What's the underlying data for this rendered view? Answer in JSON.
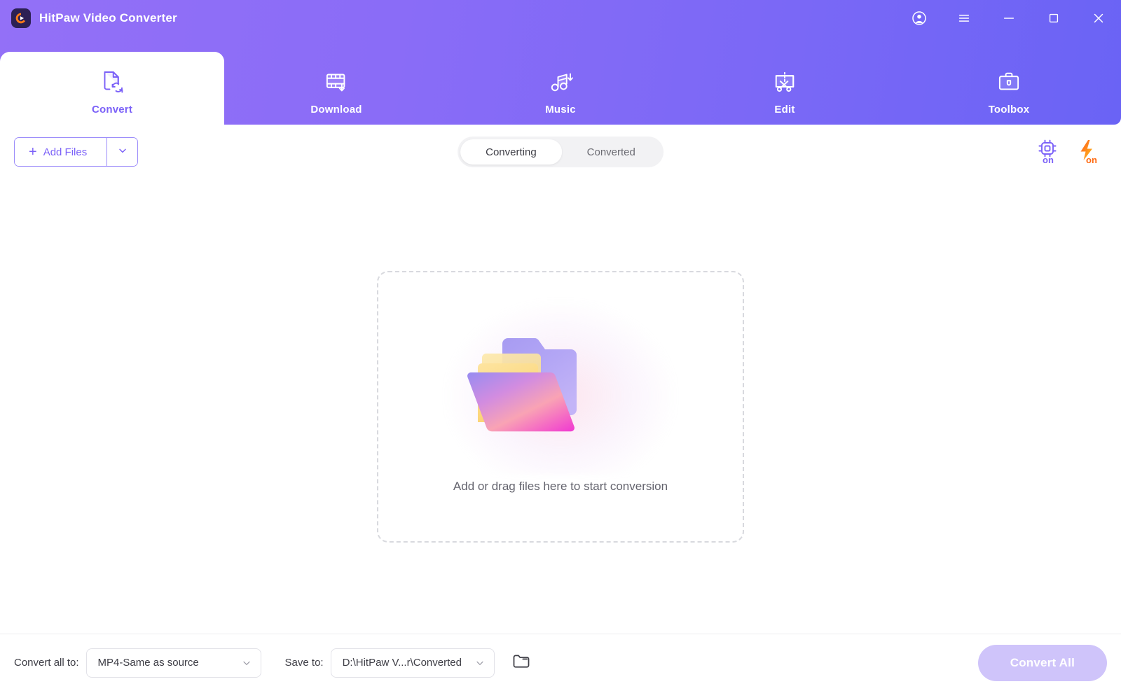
{
  "window": {
    "app_title": "HitPaw Video Converter",
    "logo_icon": "hitpaw-logo-icon",
    "controls": [
      {
        "name": "account-icon",
        "label": "Account"
      },
      {
        "name": "menu-icon",
        "label": "Menu"
      },
      {
        "name": "minimize-icon",
        "label": "Minimize"
      },
      {
        "name": "maximize-icon",
        "label": "Maximize"
      },
      {
        "name": "close-icon",
        "label": "Close"
      }
    ]
  },
  "nav": {
    "tabs": [
      {
        "label": "Convert",
        "icon": "file-convert-icon",
        "active": true
      },
      {
        "label": "Download",
        "icon": "film-download-icon",
        "active": false
      },
      {
        "label": "Music",
        "icon": "music-note-download-icon",
        "active": false
      },
      {
        "label": "Edit",
        "icon": "crop-scissors-icon",
        "active": false
      },
      {
        "label": "Toolbox",
        "icon": "toolbox-briefcase-icon",
        "active": false
      }
    ]
  },
  "toolbar": {
    "add_files_label": "Add Files",
    "add_files_plus": "+",
    "add_files_caret_icon": "chevron-down-icon",
    "segments": [
      {
        "label": "Converting",
        "active": true
      },
      {
        "label": "Converted",
        "active": false
      }
    ],
    "hardware_accel": {
      "icon": "chip-icon",
      "state": "on"
    },
    "lossless_speed": {
      "icon": "lightning-bolt-icon",
      "state": "on"
    }
  },
  "main": {
    "dropzone_text": "Add or drag files here to start conversion",
    "folder_illustration_icon": "folder-files-illustration"
  },
  "bottom": {
    "convert_all_to_label": "Convert all to:",
    "format_value": "MP4-Same as source",
    "save_to_label": "Save to:",
    "save_path_value": "D:\\HitPaw V...r\\Converted",
    "browse_icon": "folder-open-icon",
    "chevron_icon": "chevron-down-icon",
    "convert_all_button": "Convert All"
  },
  "colors": {
    "brand_purple": "#7b61f8",
    "header_gradient_start": "#9370f7",
    "header_gradient_end": "#6a63f5",
    "accent_orange": "#ff7a18",
    "button_disabled": "#cfc4fa"
  }
}
